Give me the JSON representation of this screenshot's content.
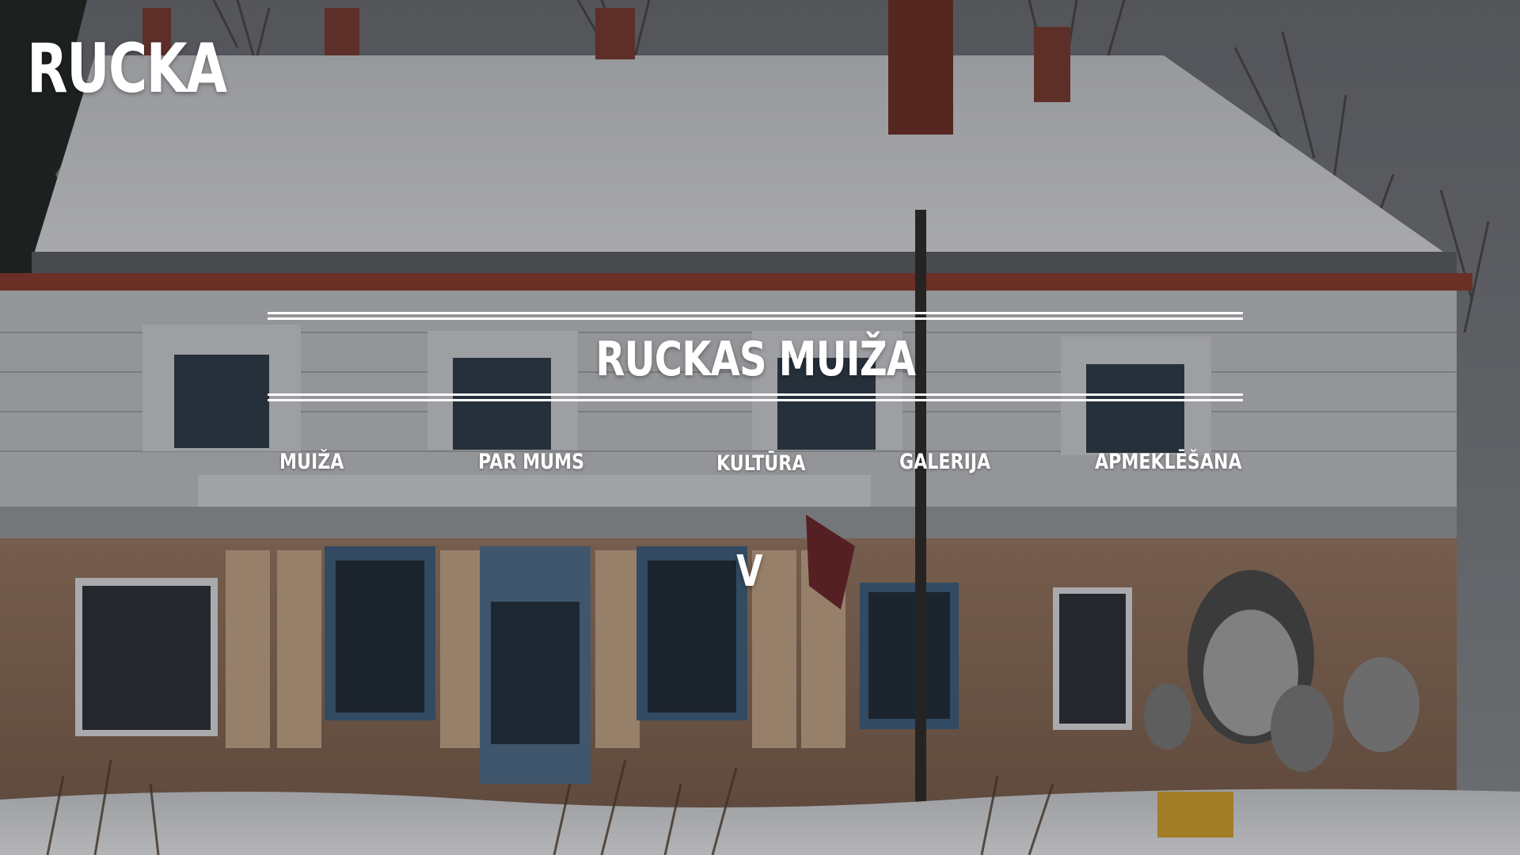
{
  "brand": {
    "logo_text": "RUCKA"
  },
  "hero": {
    "title": "RUCKAS MUIŽA",
    "background_image": "snow-covered-manor-house-photo"
  },
  "nav": {
    "items": [
      {
        "label": "MUIŽA"
      },
      {
        "label": "PAR MUMS"
      },
      {
        "label": "KULTŪRA"
      },
      {
        "label": "GALERIJA"
      },
      {
        "label": "APMEKLĒŠANA"
      }
    ]
  },
  "scroll_indicator": {
    "label": "V",
    "icon": "chevron-down-icon"
  },
  "colors": {
    "text": "#ffffff",
    "wall": "#b08a6e",
    "roof_snow": "#d9dadd",
    "window_frame": "#3e5f7e"
  }
}
